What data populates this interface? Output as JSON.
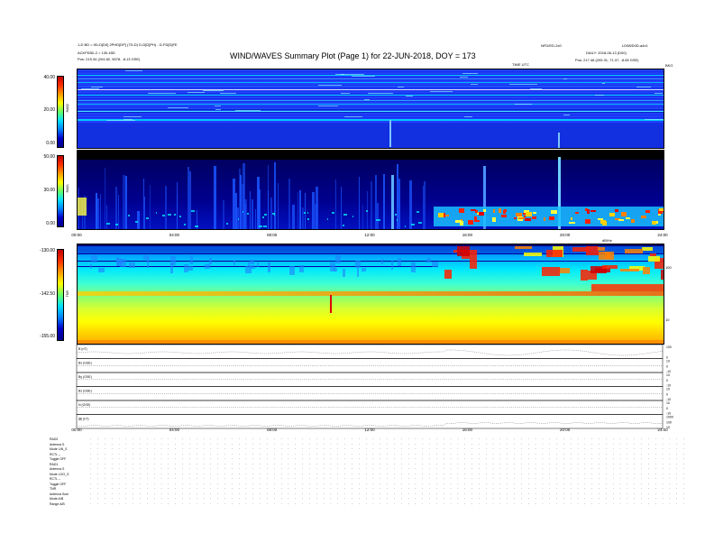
{
  "header": {
    "line1": "1-D BD = 9D-D[D0] 2PHD[DP] (7D-D) D-D[D]PH) - D-FD[D]FE",
    "line2": "ACKFE8D-2 = 130.45D",
    "line3_left": "Pos:   215.34 (204.82, 5578, -8.13 GSE)",
    "title": "WIND/WAVES Summary Plot (Page 1) for 22-JUN-2018, DOY = 173",
    "top_right_mid": "NFD/ED-2x0",
    "top_right_a": "LD98/D0D-a4x1",
    "top_right_b": "DAILY: 2018-06-13 (D00)",
    "pos_right": "Pos:   217.48 (205.31, 71.37, -8.08 GSE)",
    "time_label": "TIME UTC",
    "rad2_right": "BKG"
  },
  "colors": {
    "background": "#ffffff",
    "spectrogram_bg": "#1a3cff",
    "deep_blue": "#00008a",
    "hot": "#d81c00"
  },
  "chart_data": [
    {
      "type": "heatmap",
      "title": "RAD2",
      "yticks": [
        "40.00",
        "20.00",
        "0.00"
      ],
      "ylim": [
        0,
        40
      ],
      "x": [
        "00:00",
        "04:00",
        "08:00",
        "12:00",
        "16:00",
        "20:00",
        "24:00"
      ]
    },
    {
      "type": "heatmap",
      "title": "RAD1",
      "yticks": [
        "50.00",
        "30.00",
        "0.00"
      ],
      "ylim": [
        0,
        50
      ],
      "x": [
        "00:00",
        "04:00",
        "08:00",
        "12:00",
        "16:00",
        "20:00",
        "24:00"
      ]
    },
    {
      "type": "heatmap",
      "title": "TNR",
      "yticks": [
        "-130.00",
        "-142.50",
        "-155.00"
      ],
      "ylim": [
        -155,
        -130
      ],
      "right_axis": [
        "100",
        "10"
      ],
      "right_axis_label": "dB/Hz",
      "x": [
        "00:00",
        "04:00",
        "08:00",
        "12:00",
        "16:00",
        "20:00",
        "24:00"
      ]
    },
    {
      "type": "line",
      "title": "MAG",
      "series": [
        {
          "name": "B (nT)",
          "right_ticks": [
            "100",
            "0"
          ]
        },
        {
          "name": "Bx (GSE)",
          "right_ticks": [
            "10",
            "0",
            "-10"
          ]
        },
        {
          "name": "By (GSE)",
          "right_ticks": [
            "10",
            "0",
            "-10"
          ]
        },
        {
          "name": "Bz (GSE)",
          "right_ticks": [
            "10",
            "0",
            "-10"
          ]
        },
        {
          "name": "N (GSE)",
          "right_ticks": [
            "10",
            "0",
            "-10"
          ]
        },
        {
          "name": "|B| (nT)",
          "right_ticks": [
            "1000",
            "100",
            "10"
          ]
        }
      ],
      "x": [
        "00:00",
        "04:00",
        "08:00",
        "12:00",
        "16:00",
        "20:00",
        "24:00"
      ]
    }
  ],
  "status": {
    "lines": [
      {
        "label": "RAD2",
        "value": ""
      },
      {
        "label": "Antenna",
        "value": "S"
      },
      {
        "label": "Mode",
        "value": "LIN_S"
      },
      {
        "label": "RCTL",
        "value": "--"
      },
      {
        "label": "Toggle",
        "value": "OFF"
      },
      {
        "label": "RAD1",
        "value": ""
      },
      {
        "label": "Antenna",
        "value": "S"
      },
      {
        "label": "Mode",
        "value": "LOG_S"
      },
      {
        "label": "RCTL",
        "value": "--"
      },
      {
        "label": "Toggle",
        "value": "OFF"
      },
      {
        "label": "TNR",
        "value": ""
      },
      {
        "label": "Antenna",
        "value": "Sum"
      },
      {
        "label": "Mode",
        "value": "A/B"
      },
      {
        "label": "Range",
        "value": "A/B"
      }
    ]
  }
}
